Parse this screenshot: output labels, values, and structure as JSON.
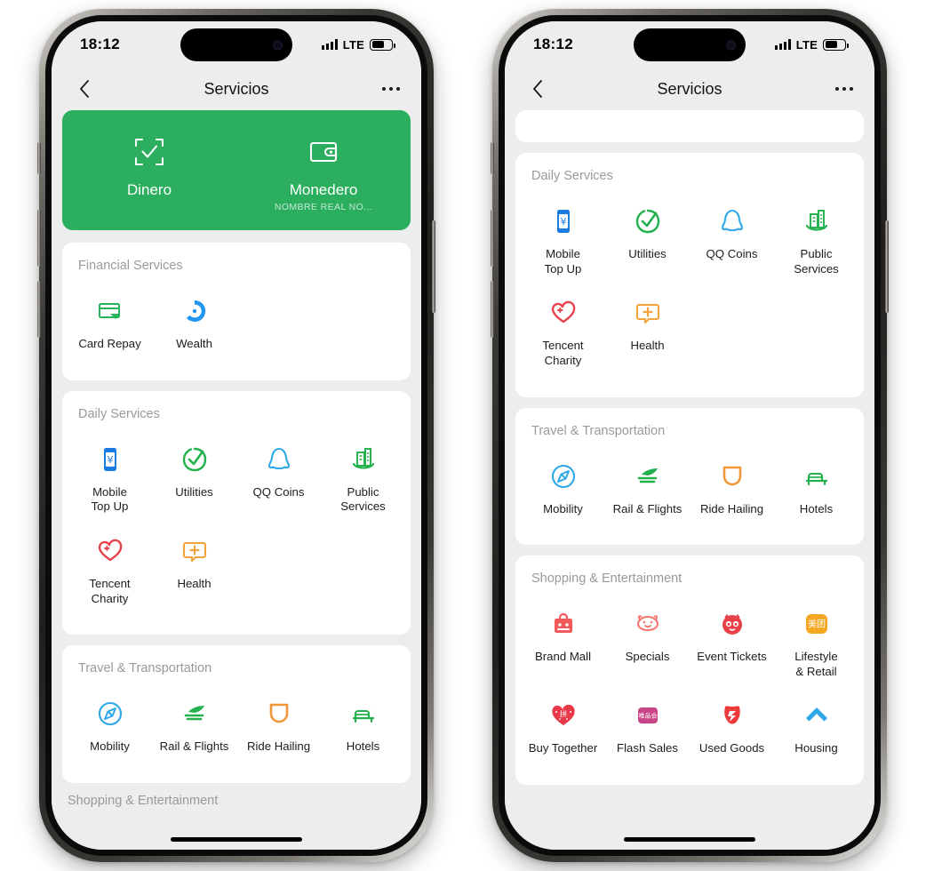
{
  "status_bar": {
    "time": "18:12",
    "network": "LTE",
    "signal_icon": "cellular-bars-icon",
    "battery_icon": "battery-icon",
    "dynamic_island": "dynamic-island"
  },
  "nav": {
    "back_icon": "chevron-left-icon",
    "title": "Servicios",
    "more_icon": "more-options-icon"
  },
  "quick_actions": [
    {
      "label": "Dinero",
      "sub": "",
      "icon": "scan-money-icon"
    },
    {
      "label": "Monedero",
      "sub": "NOMBRE REAL NO...",
      "icon": "wallet-icon"
    }
  ],
  "sections": {
    "financial": {
      "title": "Financial Services",
      "items": [
        {
          "label": "Card Repay",
          "icon": "credit-card-repay-icon",
          "color": "#2BAE5E"
        },
        {
          "label": "Wealth",
          "icon": "wealth-circle-icon",
          "color": "#2196F3"
        }
      ]
    },
    "daily": {
      "title": "Daily Services",
      "items": [
        {
          "label": "Mobile\nTop Up",
          "icon": "mobile-topup-icon",
          "color": "#1A7BE0"
        },
        {
          "label": "Utilities",
          "icon": "utilities-check-icon",
          "color": "#22B14C"
        },
        {
          "label": "QQ Coins",
          "icon": "qq-penguin-icon",
          "color": "#2FA8E8"
        },
        {
          "label": "Public\nServices",
          "icon": "public-services-icon",
          "color": "#22B14C"
        },
        {
          "label": "Tencent\nCharity",
          "icon": "charity-heart-icon",
          "color": "#E8424C"
        },
        {
          "label": "Health",
          "icon": "health-plus-icon",
          "color": "#F2A33C"
        }
      ]
    },
    "travel": {
      "title": "Travel & Transportation",
      "items": [
        {
          "label": "Mobility",
          "icon": "mobility-compass-icon",
          "color": "#2FA8E8"
        },
        {
          "label": "Rail & Flights",
          "icon": "rail-flights-icon",
          "color": "#22B14C"
        },
        {
          "label": "Ride Hailing",
          "icon": "ride-hailing-icon",
          "color": "#F0973A"
        },
        {
          "label": "Hotels",
          "icon": "hotel-bed-icon",
          "color": "#22B14C"
        }
      ]
    },
    "shopping": {
      "title": "Shopping & Entertainment",
      "items": [
        {
          "label": "Brand Mall",
          "icon": "brand-mall-bag-icon",
          "color": "#F05A5A"
        },
        {
          "label": "Specials",
          "icon": "specials-pig-icon",
          "color": "#F4766E"
        },
        {
          "label": "Event Tickets",
          "icon": "event-tickets-cat-icon",
          "color": "#E8414A"
        },
        {
          "label": "Lifestyle\n& Retail",
          "icon": "meituan-icon",
          "color": "#F5A623"
        },
        {
          "label": "Buy Together",
          "icon": "pinduoduo-heart-icon",
          "color": "#E8394A"
        },
        {
          "label": "Flash Sales",
          "icon": "vip-flash-sales-icon",
          "color": "#C94488"
        },
        {
          "label": "Used Goods",
          "icon": "used-goods-shield-icon",
          "color": "#F03A3A"
        },
        {
          "label": "Housing",
          "icon": "housing-icon",
          "color": "#2BA7E8"
        }
      ]
    }
  },
  "right_phone": {
    "clipped_section_note": ""
  },
  "left_phone": {
    "clipped_bottom_title": "Shopping & Entertainment"
  },
  "theme": {
    "green": "#2BAE5E",
    "page_bg": "#ededed",
    "card_bg": "#ffffff",
    "section_title": "#9a9a9a",
    "label": "#1c1c1c"
  }
}
